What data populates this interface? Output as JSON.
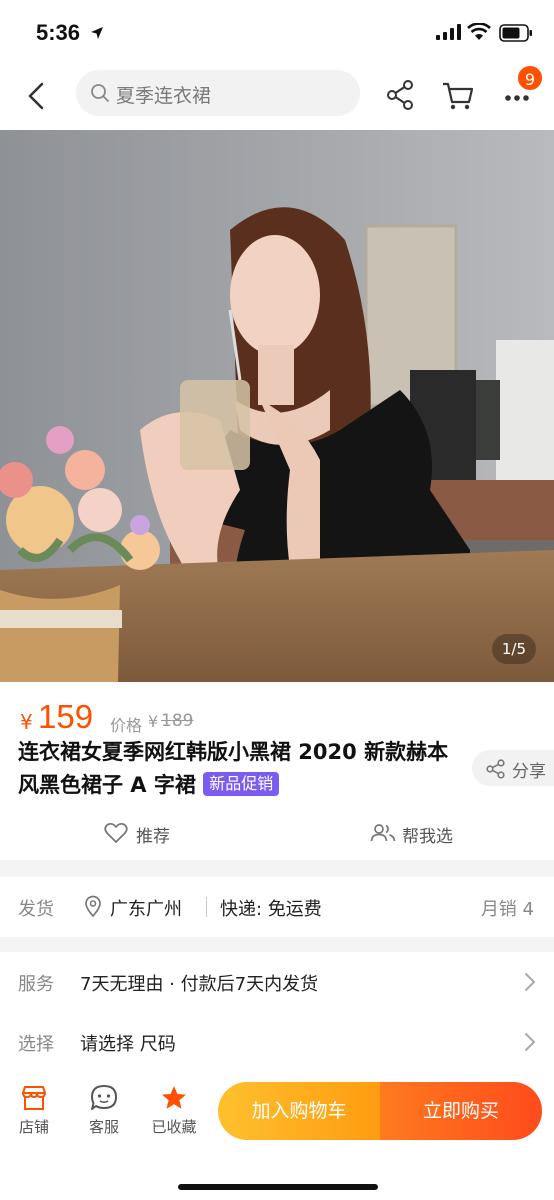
{
  "status_bar": {
    "time": "5:36"
  },
  "nav": {
    "search_placeholder": "夏季连衣裙",
    "badge_count": "9"
  },
  "gallery": {
    "page_indicator": "1/5"
  },
  "product": {
    "currency": "¥",
    "price": "159",
    "original_label": "价格",
    "original_currency": "¥",
    "original_price": "189",
    "title": "连衣裙女夏季网红韩版小黑裙 2020 新款赫本风黑色裙子 A 字裙",
    "tag": "新品促销",
    "share_label": "分享",
    "recommend_label": "推荐",
    "help_choose_label": "帮我选"
  },
  "shipping": {
    "label": "发货",
    "location": "广东广州",
    "express": "快递: 免运费",
    "monthly_sales": "月销 4"
  },
  "service": {
    "label": "服务",
    "value": "7天无理由 · 付款后7天内发货"
  },
  "select": {
    "label": "选择",
    "value": "请选择 尺码"
  },
  "bottom": {
    "store_label": "店铺",
    "service_label": "客服",
    "favorite_label": "已收藏",
    "add_cart_label": "加入购物车",
    "buy_now_label": "立即购买"
  },
  "colors": {
    "accent": "#ff5000",
    "tag_purple": "#7b5cf0",
    "cart_button": "#ffa81e",
    "buy_button": "#ff5a1e"
  }
}
